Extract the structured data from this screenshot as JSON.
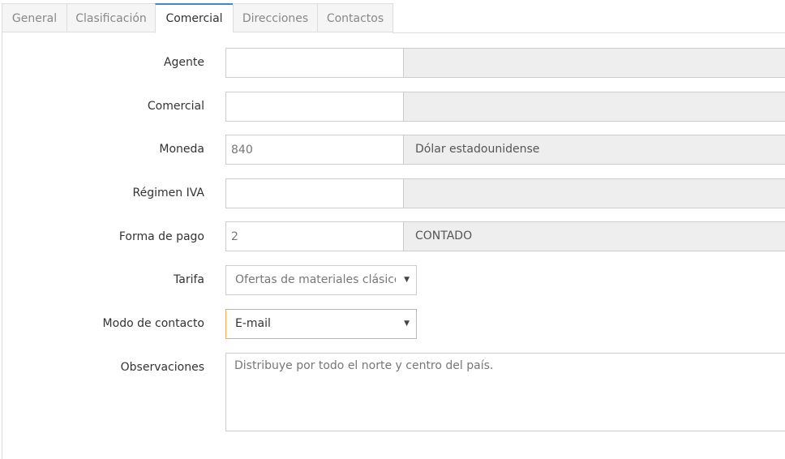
{
  "tabs": [
    {
      "label": "General",
      "active": false
    },
    {
      "label": "Clasificación",
      "active": false
    },
    {
      "label": "Comercial",
      "active": true
    },
    {
      "label": "Direcciones",
      "active": false
    },
    {
      "label": "Contactos",
      "active": false
    }
  ],
  "form": {
    "agente": {
      "label": "Agente",
      "code": "",
      "description": ""
    },
    "comercial": {
      "label": "Comercial",
      "code": "",
      "description": ""
    },
    "moneda": {
      "label": "Moneda",
      "code": "840",
      "description": "Dólar estadounidense"
    },
    "regimen_iva": {
      "label": "Régimen IVA",
      "code": "",
      "description": ""
    },
    "forma_pago": {
      "label": "Forma de pago",
      "code": "2",
      "description": "CONTADO"
    },
    "tarifa": {
      "label": "Tarifa",
      "selected": "Ofertas de materiales clásicos"
    },
    "modo_contacto": {
      "label": "Modo de contacto",
      "selected": "E-mail"
    },
    "observaciones": {
      "label": "Observaciones",
      "value": "Distribuye por todo el norte y centro del país."
    }
  },
  "icons": {
    "dropdown": "chevron-down-icon"
  },
  "colors": {
    "active_tab_accent": "#3c8dbc",
    "focus_border": "#f0ad4e",
    "readonly_bg": "#eeeeee"
  }
}
